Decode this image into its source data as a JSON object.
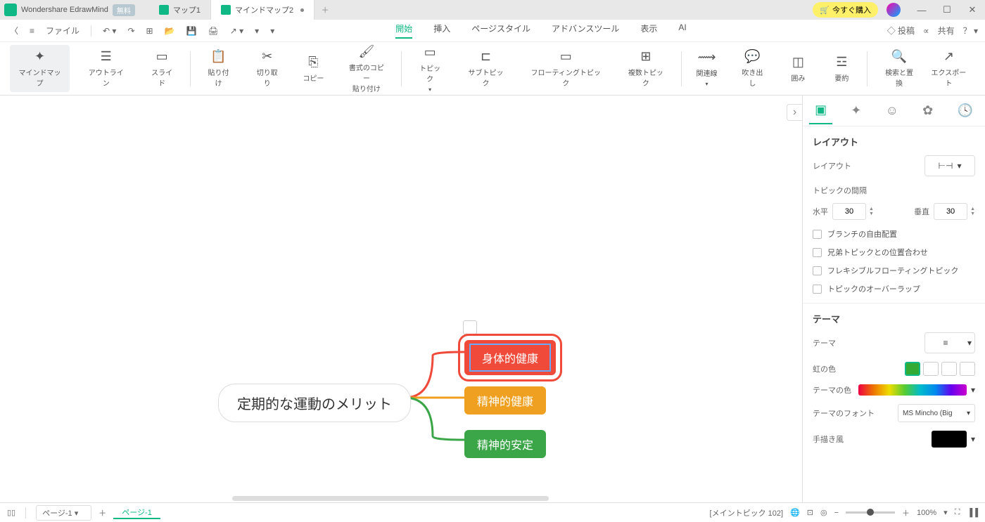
{
  "app": {
    "name": "Wondershare EdrawMind",
    "free_badge": "無料"
  },
  "tabs": [
    {
      "label": "マップ1",
      "active": false
    },
    {
      "label": "マインドマップ2",
      "active": true,
      "dirty": true
    }
  ],
  "title_actions": {
    "buy": "今すぐ購入"
  },
  "menu": {
    "file": "ファイル",
    "tabs": [
      "開始",
      "挿入",
      "ページスタイル",
      "アドバンスツール",
      "表示",
      "AI"
    ],
    "active_tab": 0,
    "right": {
      "post": "投稿",
      "share": "共有"
    }
  },
  "ribbon": {
    "view_modes": [
      "マインドマップ",
      "アウトライン",
      "スライド"
    ],
    "clipboard": {
      "paste": "貼り付け",
      "cut": "切り取り",
      "copy": "コピー",
      "format_painter": "書式のコピー\n貼り付け"
    },
    "topics": {
      "topic": "トピック",
      "subtopic": "サブトピック",
      "floating": "フローティングトピック",
      "multi": "複数トピック"
    },
    "insert": {
      "relation": "関連線",
      "callout": "吹き出し",
      "boundary": "囲み",
      "summary": "要約"
    },
    "tools": {
      "find": "検索と置換"
    },
    "export": "エクスポート"
  },
  "mindmap": {
    "central": "定期的な運動のメリット",
    "topics": [
      "身体的健康",
      "精神的健康",
      "精神的安定"
    ]
  },
  "side_panel": {
    "layout_section": "レイアウト",
    "layout_label": "レイアウト",
    "spacing_label": "トピックの間隔",
    "horizontal": "水平",
    "horizontal_val": "30",
    "vertical": "垂直",
    "vertical_val": "30",
    "checks": [
      "ブランチの自由配置",
      "兄弟トピックとの位置合わせ",
      "フレキシブルフローティングトピック",
      "トピックのオーバーラップ"
    ],
    "theme_section": "テーマ",
    "theme_label": "テーマ",
    "rainbow_label": "虹の色",
    "theme_color_label": "テーマの色",
    "theme_font_label": "テーマのフォント",
    "theme_font_val": "MS Mincho (Big",
    "hand_label": "手描き風"
  },
  "status": {
    "page_select": "ページ-1",
    "page_tab": "ページ-1",
    "main_topic": "[メイントピック 102]",
    "zoom": "100%"
  }
}
